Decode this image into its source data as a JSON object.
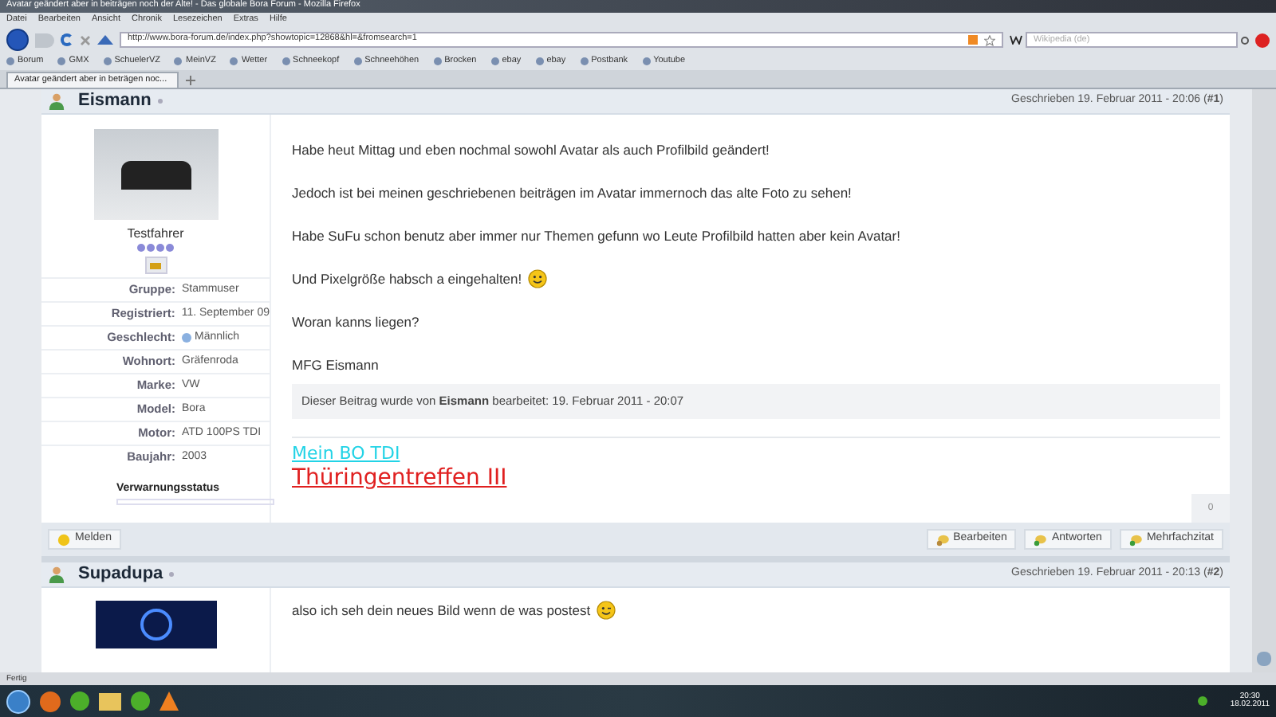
{
  "window": {
    "title": "Avatar geändert aber in beiträgen noch der Alte! - Das globale Bora Forum - Mozilla Firefox"
  },
  "menu": [
    "Datei",
    "Bearbeiten",
    "Ansicht",
    "Chronik",
    "Lesezeichen",
    "Extras",
    "Hilfe"
  ],
  "address_bar": {
    "value": "http://www.bora-forum.de/index.php?showtopic=12868&hl=&fromsearch=1"
  },
  "search_field": {
    "placeholder": "Wikipedia (de)"
  },
  "bookmarks": [
    "Borum",
    "GMX",
    "SchuelerVZ",
    "MeinVZ",
    "Wetter",
    "Schneekopf",
    "Schneehöhen",
    "Brocken",
    "ebay",
    "ebay",
    "Postbank",
    "Youtube"
  ],
  "tabs": [
    {
      "label": "Avatar geändert aber in beträgen noc...",
      "selected": true
    }
  ],
  "posts": [
    {
      "author": "Eismann",
      "date": "Geschrieben 19. Februar 2011 - 20:06 (**#1**)",
      "rank": "Testfahrer",
      "stars": 4,
      "profile": [
        {
          "label": "Gruppe:",
          "value": "Stammuser"
        },
        {
          "label": "Registriert:",
          "value": "11. September 09"
        },
        {
          "label": "Geschlecht:",
          "value": "Männlich"
        },
        {
          "label": "Wohnort:",
          "value": "Gräfenroda"
        },
        {
          "label": "Marke:",
          "value": "VW"
        },
        {
          "label": "Model:",
          "value": "Bora"
        },
        {
          "label": "Motor:",
          "value": "ATD 100PS TDI"
        },
        {
          "label": "Baujahr:",
          "value": "2003"
        }
      ],
      "warning_label": "Verwarnungsstatus",
      "paragraphs": [
        "Habe heut Mittag und eben nochmal sowohl Avatar als auch Profilbild geändert!",
        "Jedoch ist bei meinen geschriebenen beiträgen im Avatar immernoch das alte Foto zu sehen!",
        "Habe SuFu schon benutz aber immer nur Themen gefunn wo Leute Profilbild hatten aber kein Avatar!",
        "Und Pixelgröße habsch a eingehalten!",
        "Woran kanns liegen?",
        "MFG Eismann"
      ],
      "edit_note": "Dieser Beitrag wurde von **Eismann** bearbeitet: 19. Februar 2011 - 20:07",
      "signature": [
        {
          "text": "Mein BO TDI",
          "color": "#22d3e6"
        },
        {
          "text": "Thüringentreffen III",
          "color": "#e02020"
        }
      ],
      "likes": "0",
      "actions": [
        "Melden",
        "Bearbeiten",
        "Antworten",
        "Mehrfachzitat"
      ]
    },
    {
      "author": "Supadupa",
      "date": "Geschrieben 19. Februar 2011 - 20:13 (**#2**)",
      "paragraphs": [
        "also ich seh dein neues Bild wenn de was postest"
      ]
    }
  ],
  "status_bar": {
    "text": "Fertig"
  },
  "taskbar": {
    "time": "20:30",
    "date": "18.02.2011"
  }
}
